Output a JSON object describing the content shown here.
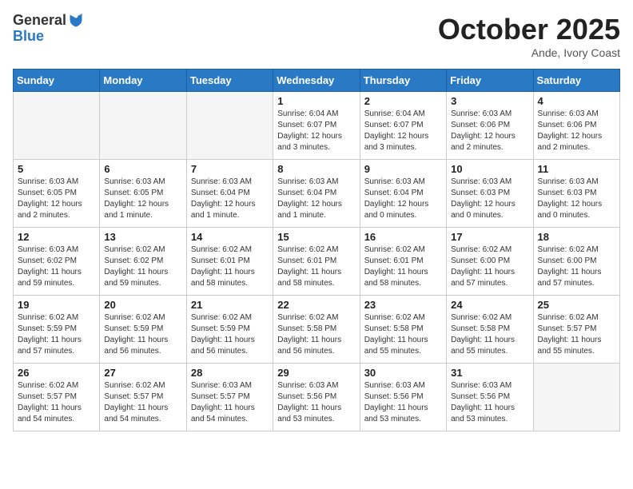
{
  "logo": {
    "general": "General",
    "blue": "Blue"
  },
  "title": "October 2025",
  "location": "Ande, Ivory Coast",
  "days_header": [
    "Sunday",
    "Monday",
    "Tuesday",
    "Wednesday",
    "Thursday",
    "Friday",
    "Saturday"
  ],
  "weeks": [
    [
      {
        "day": "",
        "info": ""
      },
      {
        "day": "",
        "info": ""
      },
      {
        "day": "",
        "info": ""
      },
      {
        "day": "1",
        "info": "Sunrise: 6:04 AM\nSunset: 6:07 PM\nDaylight: 12 hours\nand 3 minutes."
      },
      {
        "day": "2",
        "info": "Sunrise: 6:04 AM\nSunset: 6:07 PM\nDaylight: 12 hours\nand 3 minutes."
      },
      {
        "day": "3",
        "info": "Sunrise: 6:03 AM\nSunset: 6:06 PM\nDaylight: 12 hours\nand 2 minutes."
      },
      {
        "day": "4",
        "info": "Sunrise: 6:03 AM\nSunset: 6:06 PM\nDaylight: 12 hours\nand 2 minutes."
      }
    ],
    [
      {
        "day": "5",
        "info": "Sunrise: 6:03 AM\nSunset: 6:05 PM\nDaylight: 12 hours\nand 2 minutes."
      },
      {
        "day": "6",
        "info": "Sunrise: 6:03 AM\nSunset: 6:05 PM\nDaylight: 12 hours\nand 1 minute."
      },
      {
        "day": "7",
        "info": "Sunrise: 6:03 AM\nSunset: 6:04 PM\nDaylight: 12 hours\nand 1 minute."
      },
      {
        "day": "8",
        "info": "Sunrise: 6:03 AM\nSunset: 6:04 PM\nDaylight: 12 hours\nand 1 minute."
      },
      {
        "day": "9",
        "info": "Sunrise: 6:03 AM\nSunset: 6:04 PM\nDaylight: 12 hours\nand 0 minutes."
      },
      {
        "day": "10",
        "info": "Sunrise: 6:03 AM\nSunset: 6:03 PM\nDaylight: 12 hours\nand 0 minutes."
      },
      {
        "day": "11",
        "info": "Sunrise: 6:03 AM\nSunset: 6:03 PM\nDaylight: 12 hours\nand 0 minutes."
      }
    ],
    [
      {
        "day": "12",
        "info": "Sunrise: 6:03 AM\nSunset: 6:02 PM\nDaylight: 11 hours\nand 59 minutes."
      },
      {
        "day": "13",
        "info": "Sunrise: 6:02 AM\nSunset: 6:02 PM\nDaylight: 11 hours\nand 59 minutes."
      },
      {
        "day": "14",
        "info": "Sunrise: 6:02 AM\nSunset: 6:01 PM\nDaylight: 11 hours\nand 58 minutes."
      },
      {
        "day": "15",
        "info": "Sunrise: 6:02 AM\nSunset: 6:01 PM\nDaylight: 11 hours\nand 58 minutes."
      },
      {
        "day": "16",
        "info": "Sunrise: 6:02 AM\nSunset: 6:01 PM\nDaylight: 11 hours\nand 58 minutes."
      },
      {
        "day": "17",
        "info": "Sunrise: 6:02 AM\nSunset: 6:00 PM\nDaylight: 11 hours\nand 57 minutes."
      },
      {
        "day": "18",
        "info": "Sunrise: 6:02 AM\nSunset: 6:00 PM\nDaylight: 11 hours\nand 57 minutes."
      }
    ],
    [
      {
        "day": "19",
        "info": "Sunrise: 6:02 AM\nSunset: 5:59 PM\nDaylight: 11 hours\nand 57 minutes."
      },
      {
        "day": "20",
        "info": "Sunrise: 6:02 AM\nSunset: 5:59 PM\nDaylight: 11 hours\nand 56 minutes."
      },
      {
        "day": "21",
        "info": "Sunrise: 6:02 AM\nSunset: 5:59 PM\nDaylight: 11 hours\nand 56 minutes."
      },
      {
        "day": "22",
        "info": "Sunrise: 6:02 AM\nSunset: 5:58 PM\nDaylight: 11 hours\nand 56 minutes."
      },
      {
        "day": "23",
        "info": "Sunrise: 6:02 AM\nSunset: 5:58 PM\nDaylight: 11 hours\nand 55 minutes."
      },
      {
        "day": "24",
        "info": "Sunrise: 6:02 AM\nSunset: 5:58 PM\nDaylight: 11 hours\nand 55 minutes."
      },
      {
        "day": "25",
        "info": "Sunrise: 6:02 AM\nSunset: 5:57 PM\nDaylight: 11 hours\nand 55 minutes."
      }
    ],
    [
      {
        "day": "26",
        "info": "Sunrise: 6:02 AM\nSunset: 5:57 PM\nDaylight: 11 hours\nand 54 minutes."
      },
      {
        "day": "27",
        "info": "Sunrise: 6:02 AM\nSunset: 5:57 PM\nDaylight: 11 hours\nand 54 minutes."
      },
      {
        "day": "28",
        "info": "Sunrise: 6:03 AM\nSunset: 5:57 PM\nDaylight: 11 hours\nand 54 minutes."
      },
      {
        "day": "29",
        "info": "Sunrise: 6:03 AM\nSunset: 5:56 PM\nDaylight: 11 hours\nand 53 minutes."
      },
      {
        "day": "30",
        "info": "Sunrise: 6:03 AM\nSunset: 5:56 PM\nDaylight: 11 hours\nand 53 minutes."
      },
      {
        "day": "31",
        "info": "Sunrise: 6:03 AM\nSunset: 5:56 PM\nDaylight: 11 hours\nand 53 minutes."
      },
      {
        "day": "",
        "info": ""
      }
    ]
  ]
}
